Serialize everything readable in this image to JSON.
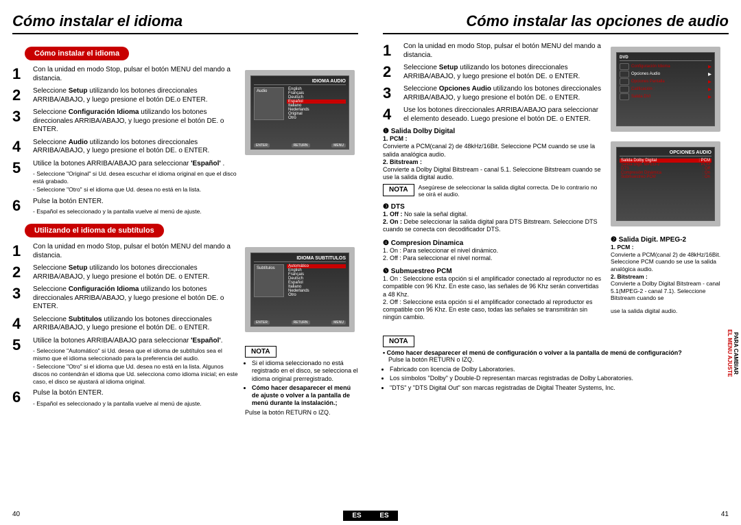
{
  "page_left": {
    "title": "Cómo instalar el idioma",
    "section1": "Cómo instalar el idioma",
    "steps1": [
      {
        "t": "Con la unidad en modo Stop, pulsar el botón MENU del mando a distancia."
      },
      {
        "t": "Seleccione Setup utilizando los botones direccionales ARRIBA/ABAJO, y luego presione el botón DE.o ENTER."
      },
      {
        "t": "Seleccione Configuración Idioma utilizando los botones direccionales ARRIBA/ABAJO, y luego presione el botón DE. o ENTER."
      },
      {
        "t": "Seleccione Audio utilizando los botones direccionales ARRIBA/ABAJO, y luego presione el botón DE. o ENTER."
      },
      {
        "t": "Utilice la botones ARRIBA/ABAJO para seleccionar 'Español' .",
        "sub": [
          "- Seleccione \"Original\" si Ud. desea escuchar el idioma original en que el disco está grabado.",
          "- Seleccione \"Otro\" si el idioma que Ud. desea no está en la lista."
        ]
      },
      {
        "t": "Pulse la botón ENTER.",
        "sub": [
          "- Español es seleccionado y la pantalla vuelve al menú de ajuste."
        ]
      }
    ],
    "section2": "Utilizando el idioma de subtítulos",
    "steps2": [
      {
        "t": "Con la unidad en modo Stop, pulsar el botón MENU del mando a distancia."
      },
      {
        "t": "Seleccione Setup utilizando los botones direccionales ARRIBA/ABAJO, y luego presione el botón DE. o ENTER."
      },
      {
        "t": "Seleccione Configuración Idioma utilizando los botones direccionales ARRIBA/ABAJO, y luego presione el botón DE. o ENTER."
      },
      {
        "t": "Seleccione Subtitulos utilizando los botones direccionales ARRIBA/ABAJO, y luego presione el botón DE. o ENTER."
      },
      {
        "t": "Utilice la botones ARRIBA/ABAJO para seleccionar 'Español'.",
        "sub": [
          "- Seleccione \"Automático\" si Ud. desea que el idioma de subtítulos sea el mismo que el idioma seleccionado para la preferencia del audio.",
          "- Seleccione \"Otro\" si el idioma que Ud. desea no está en la lista. Algunos discos no contendrán el idioma que Ud. selecciona como idioma inicial; en este caso, el disco se ajustará al idioma original."
        ]
      },
      {
        "t": "Pulse la botón ENTER.",
        "sub": [
          "- Español es seleccionado y la pantalla vuelve al menú de ajuste."
        ]
      }
    ],
    "tv1": {
      "hdr": "IDIOMA AUDIO",
      "side": "Audio",
      "langs": [
        "English",
        "Français",
        "Deutsch",
        "Español",
        "Italiano",
        "Nederlands",
        "Original",
        "Otro"
      ],
      "hl": 3
    },
    "tv2": {
      "hdr": "IDIOMA SUBTITULOS",
      "side": "Subtítulos",
      "langs": [
        "Automático",
        "English",
        "Français",
        "Deutsch",
        "Español",
        "Italiano",
        "Nederlands",
        "Otro"
      ],
      "hl": 0
    },
    "nota": {
      "label": "NOTA",
      "items": [
        "Si el idioma seleccionado no está registrado en el disco, se selecciona el idioma original prerregistrado.",
        "Cómo hacer desaparecer el menú de ajuste o volver a la pantalla de menú durante la instalación.;"
      ],
      "tail": "Pulse la botón RETURN o IZQ."
    },
    "pagenum": "40",
    "es": "ES"
  },
  "page_right": {
    "title": "Cómo instalar las opciones de audio",
    "steps": [
      {
        "t": "Con la unidad en modo Stop, pulsar el botón MENU del mando a distancia."
      },
      {
        "t": "Seleccione Setup utilizando los botones direccionales ARRIBA/ABAJO, y luego presione el botón DE. o ENTER."
      },
      {
        "t": "Seleccione Opciones Audio utilizando los botones direccionales ARRIBA/ABAJO, y luego presione el botón DE. o ENTER."
      },
      {
        "t": "Use los botones direccionales ARRIBA/ABAJO para seleccionar el elemento deseado. Luego presione el botón DE. o ENTER."
      }
    ],
    "tv_cfg": {
      "hdr": "DVD",
      "rows": [
        {
          "i": "Disc Menu",
          "t": "Configuración Idioma"
        },
        {
          "i": "Title Menu",
          "t": "Opciones Audio",
          "sel": true
        },
        {
          "i": "Function",
          "t": "Opciones Pantalla"
        },
        {
          "i": "Setup",
          "t": "Calificación    : "
        },
        {
          "i": "",
          "t": "Salida DVI"
        }
      ]
    },
    "tv_audio": {
      "hdr": "OPCIONES AUDIO",
      "rows": [
        {
          "l": "Salida Dolby Digital",
          "r": ": PCM",
          "sel": true
        },
        {
          "l": "Salida Digit. MPEG-2",
          "r": ": PCM"
        },
        {
          "l": "DTS",
          "r": ": Off"
        },
        {
          "l": "Compresión Dinámica",
          "r": ": On"
        },
        {
          "l": "Submuestreo PCM",
          "r": ": On"
        }
      ]
    },
    "sec1": {
      "title": "❶ Salida Dolby Digital",
      "pcm_h": "1. PCM :",
      "pcm_t": "Convierte a PCM(canal 2) de 48kHz/16Bit. Seleccione PCM cuando se use la salida analógica audio.",
      "bs_h": "2. Bitstream :",
      "bs_t": "Convierte a Dolby Digital Bitstream - canal 5.1. Seleccione Bitstream cuando se use la salida digital audio.",
      "nota": "NOTA",
      "nota_t": "Asegúrese de seleccionar la salida digital correcta. De lo contrario no se oirá el audio."
    },
    "sec2": {
      "title": "❷ Salida Digit. MPEG-2",
      "pcm_h": "1. PCM :",
      "pcm_t": "Convierte a PCM(canal 2) de 48kHz/16Bit. Seleccione PCM cuando se use la salida analógica audio.",
      "bs_h": "2. Bitstream :",
      "bs_t": "Convierte a Dolby Digital Bitstream - canal 5.1(MPEG-2 - canal 7.1). Seleccione Bitstream cuando se",
      "tail": "use la salida digital audio."
    },
    "sec3": {
      "title": "❸ DTS",
      "off": "1. Off : No sale la señal digital.",
      "on": "2. On : Debe seleccionar la salida digital para DTS Bitstream. Seleccione DTS cuando se conecta con decodificador DTS."
    },
    "sec4": {
      "title": "❹ Compresion Dinamica",
      "on": "1. On : Para seleccionar el nivel dinámico.",
      "off": "2. Off : Para seleccionar el nivel normal."
    },
    "sec5": {
      "title": "❺ Submuestreo PCM",
      "on": "1. On : Seleccione esta opción si el amplificador conectado al reproductor no es compatible con 96 Khz. En este caso, las señales de 96 Khz serán convertidas a 48 Khz.",
      "off": "2. Off : Seleccione esta opción si el amplificador conectado al reproductor es compatible con 96 Khz. En este caso, todas las señales se transmitirán sin ningún cambio."
    },
    "bottom_nota": {
      "label": "NOTA",
      "q": "• Cómo hacer desaparecer el menú de configuración o volver a la pantalla de menú de configuración?",
      "q2": "Pulse la botón RETURN o IZQ.",
      "l2": "Fabricado con licencia de Dolby Laboratories.",
      "l3": "Los símbolos \"Dolby\" y Double-D representan marcas registradas de Dolby Laboratories.",
      "l4": "\"DTS\" y \"DTS Digital Out\" son marcas registradas de Digital Theater Systems, Inc."
    },
    "pagenum": "41",
    "es": "ES",
    "side_tab": {
      "l1": "PARA CAMBIAR",
      "l2": "EL MENU AJUSTE"
    }
  }
}
